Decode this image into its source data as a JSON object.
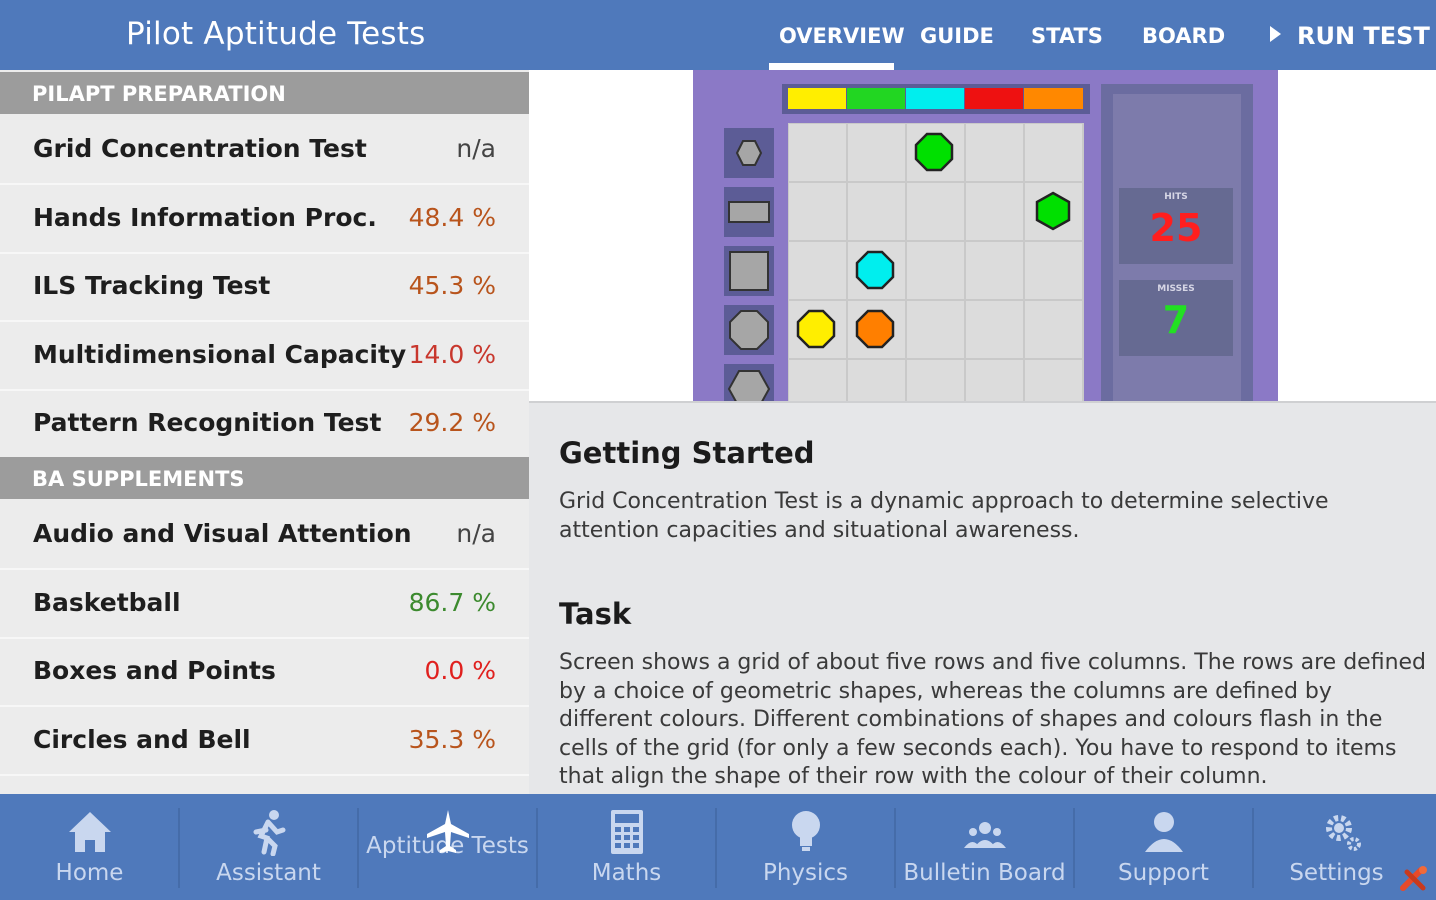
{
  "header": {
    "title": "Pilot Aptitude Tests",
    "tabs": [
      "OVERVIEW",
      "GUIDE",
      "STATS",
      "BOARD"
    ],
    "active_tab": "OVERVIEW",
    "run_test": "RUN TEST"
  },
  "sidebar": {
    "sections": [
      {
        "title": "PILAPT PREPARATION",
        "items": [
          {
            "name": "Grid Concentration Test",
            "score": "n/a",
            "color": "#444444"
          },
          {
            "name": "Hands Information Proc.",
            "score": "48.4 %",
            "color": "#b8541c"
          },
          {
            "name": "ILS Tracking Test",
            "score": "45.3 %",
            "color": "#b8541c"
          },
          {
            "name": "Multidimensional Capacity",
            "score": "14.0 %",
            "color": "#c8372d"
          },
          {
            "name": "Pattern Recognition Test",
            "score": "29.2 %",
            "color": "#b8541c"
          }
        ]
      },
      {
        "title": "BA SUPPLEMENTS",
        "items": [
          {
            "name": "Audio and Visual Attention",
            "score": "n/a",
            "color": "#444444"
          },
          {
            "name": "Basketball",
            "score": "86.7 %",
            "color": "#3c8a2e"
          },
          {
            "name": "Boxes and Points",
            "score": "0.0 %",
            "color": "#e0201e"
          },
          {
            "name": "Circles and Bell",
            "score": "35.3 %",
            "color": "#b8541c"
          }
        ]
      }
    ]
  },
  "preview": {
    "color_bar": [
      "#ffee00",
      "#22d622",
      "#00eeee",
      "#ee1111",
      "#ff8800"
    ],
    "row_shapes": [
      "hexagon",
      "rectangle",
      "square",
      "octagon",
      "hexagon"
    ],
    "pieces": [
      {
        "row": 0,
        "col": 2,
        "shape": "octagon",
        "color": "#00e000"
      },
      {
        "row": 1,
        "col": 4,
        "shape": "hexagon",
        "color": "#00e000"
      },
      {
        "row": 2,
        "col": 1,
        "shape": "octagon",
        "color": "#00eeee"
      },
      {
        "row": 3,
        "col": 0,
        "shape": "octagon",
        "color": "#ffee00"
      },
      {
        "row": 3,
        "col": 1,
        "shape": "octagon",
        "color": "#ff7f00"
      }
    ],
    "hits_label": "HITS",
    "hits": "25",
    "hits_color": "#ff1e1e",
    "misses_label": "MISSES",
    "misses": "7",
    "misses_color": "#22e022"
  },
  "content": {
    "sections": [
      {
        "heading": "Getting Started",
        "text": "Grid Concentration Test is a dynamic approach to determine selective attention capacities and situational awareness."
      },
      {
        "heading": "Task",
        "text": "Screen shows a grid of about five rows and five columns. The rows are defined by a choice of geometric shapes, whereas the columns are defined by different colours. Different combinations of shapes and colours flash in the cells of the grid (for only a few seconds each). You have to respond to items that align the shape of their row with the colour of their column."
      }
    ]
  },
  "bottom_nav": [
    {
      "label": "Home",
      "icon": "home-icon"
    },
    {
      "label": "Assistant",
      "icon": "running-person-icon"
    },
    {
      "label": "Aptitude Tests",
      "icon": "airplane-icon"
    },
    {
      "label": "Maths",
      "icon": "calculator-icon"
    },
    {
      "label": "Physics",
      "icon": "lightbulb-icon"
    },
    {
      "label": "Bulletin Board",
      "icon": "group-icon"
    },
    {
      "label": "Support",
      "icon": "person-icon"
    },
    {
      "label": "Settings",
      "icon": "gear-icon"
    }
  ],
  "colors": {
    "brand_blue": "#4f79bb",
    "section_header": "#9c9c9c"
  }
}
